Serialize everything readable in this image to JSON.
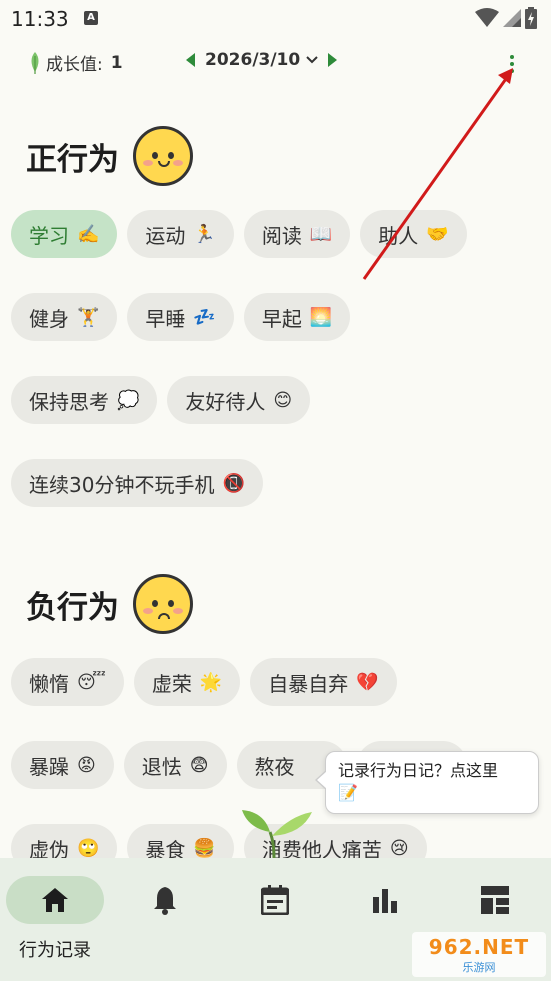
{
  "status_bar": {
    "time": "11:33",
    "notif": "A"
  },
  "top_bar": {
    "growth_label": "成长值: ",
    "growth_value": "1",
    "date": "2026/3/10"
  },
  "positive": {
    "title": "正行为",
    "rows": [
      [
        {
          "label": "学习",
          "emoji": "✍️",
          "active": true
        },
        {
          "label": "运动",
          "emoji": "🏃"
        },
        {
          "label": "阅读",
          "emoji": "📖"
        },
        {
          "label": "助人",
          "emoji": "🤝"
        }
      ],
      [
        {
          "label": "健身",
          "emoji": "🏋️"
        },
        {
          "label": "早睡",
          "emoji": "💤"
        },
        {
          "label": "早起",
          "emoji": "🌅"
        }
      ],
      [
        {
          "label": "保持思考",
          "emoji": "💭"
        },
        {
          "label": "友好待人",
          "emoji": "😊"
        }
      ],
      [
        {
          "label": "连续30分钟不玩手机",
          "emoji": "📵"
        }
      ]
    ]
  },
  "negative": {
    "title": "负行为",
    "rows": [
      [
        {
          "label": "懒惰",
          "emoji": "😴"
        },
        {
          "label": "虚荣",
          "emoji": "🌟"
        },
        {
          "label": "自暴自弃",
          "emoji": "💔"
        }
      ],
      [
        {
          "label": "暴躁",
          "emoji": "😡"
        },
        {
          "label": "退怯",
          "emoji": "😨"
        },
        {
          "label": "熬夜",
          "emoji": ""
        }
      ],
      [
        {
          "label": "虚伪",
          "emoji": "🙄"
        },
        {
          "label": "暴食",
          "emoji": "🍔"
        },
        {
          "label": "消费他人痛苦",
          "emoji": "😢"
        }
      ]
    ]
  },
  "tooltip": {
    "text": "记录行为日记？点这里",
    "emoji": "📝"
  },
  "bottom_nav": {
    "items": [
      {
        "label": "行为记录",
        "icon": "home-icon",
        "active": true
      },
      {
        "label": "",
        "icon": "bell-icon"
      },
      {
        "label": "",
        "icon": "calendar-icon"
      },
      {
        "label": "",
        "icon": "bar-chart-icon"
      },
      {
        "label": "",
        "icon": "dashboard-icon"
      }
    ]
  },
  "watermark": {
    "line1": "962.NET",
    "line2": "乐游网"
  },
  "colors": {
    "accent": "#2e8b3a",
    "active_chip": "#c5e3c7",
    "chip": "#e9e9e4",
    "annotation_arrow": "#d11a1a"
  }
}
